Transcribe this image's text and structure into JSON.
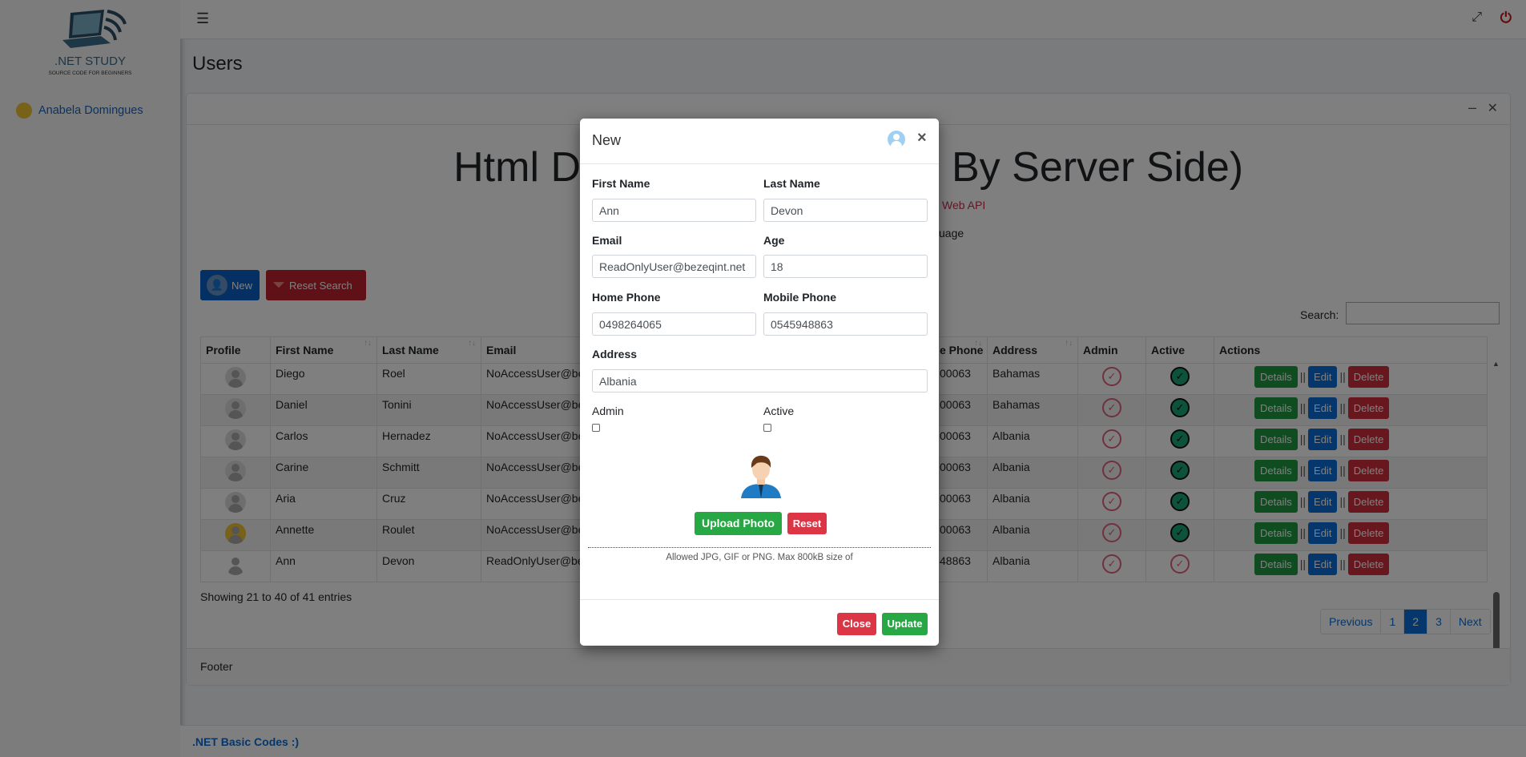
{
  "brand": {
    "title": ".NET STUDY",
    "subtitle": "SOURCE CODE FOR BEGINNERS"
  },
  "sidebar": {
    "user_name": "Anabela Domingues"
  },
  "topnav": {
    "menu_icon": "hamburger-icon",
    "expand_icon": "expand-icon",
    "power_icon": "power-icon"
  },
  "page": {
    "title": "Users"
  },
  "card": {
    "heading_left": "Html D",
    "heading_right": "By Server Side)",
    "subtitle_fragment": "Web API",
    "desc_fragment": "uage",
    "new_label": "New",
    "reset_search_label": "Reset Search",
    "search_label": "Search:",
    "footer": "Footer"
  },
  "table": {
    "headers": [
      "Profile",
      "First Name",
      "Last Name",
      "Email",
      "e Phone",
      "Address",
      "Admin",
      "Active",
      "Actions"
    ],
    "rows": [
      {
        "avatar": "default",
        "first": "Diego",
        "last": "Roel",
        "email": "NoAccessUser@be",
        "phone": "00063",
        "address": "Bahamas",
        "admin": false,
        "active": true
      },
      {
        "avatar": "default",
        "first": "Daniel",
        "last": "Tonini",
        "email": "NoAccessUser@be",
        "phone": "00063",
        "address": "Bahamas",
        "admin": false,
        "active": true
      },
      {
        "avatar": "default",
        "first": "Carlos",
        "last": "Hernadez",
        "email": "NoAccessUser@be",
        "phone": "00063",
        "address": "Albania",
        "admin": false,
        "active": true
      },
      {
        "avatar": "default",
        "first": "Carine",
        "last": "Schmitt",
        "email": "NoAccessUser@be",
        "phone": "00063",
        "address": "Albania",
        "admin": false,
        "active": true
      },
      {
        "avatar": "default",
        "first": "Aria",
        "last": "Cruz",
        "email": "NoAccessUser@be",
        "phone": "00063",
        "address": "Albania",
        "admin": false,
        "active": true
      },
      {
        "avatar": "female",
        "first": "Annette",
        "last": "Roulet",
        "email": "NoAccessUser@be",
        "phone": "00063",
        "address": "Albania",
        "admin": false,
        "active": true
      },
      {
        "avatar": "male",
        "first": "Ann",
        "last": "Devon",
        "email": "ReadOnlyUser@be",
        "phone": "48863",
        "address": "Albania",
        "admin": false,
        "active": false
      }
    ],
    "actions": {
      "details": "Details",
      "edit": "Edit",
      "delete": "Delete",
      "separator": "||"
    },
    "info": "Showing 21 to 40 of 41 entries",
    "pagination": [
      "Previous",
      "1",
      "2",
      "3",
      "Next"
    ],
    "current_page": "2"
  },
  "footer": {
    "text": ".NET Basic Codes :)"
  },
  "modal": {
    "title": "New",
    "close_symbol": "×",
    "fields": {
      "first_name": {
        "label": "First Name",
        "value": "Ann"
      },
      "last_name": {
        "label": "Last Name",
        "value": "Devon"
      },
      "email": {
        "label": "Email",
        "value": "ReadOnlyUser@bezeqint.net"
      },
      "age": {
        "label": "Age",
        "value": "18"
      },
      "home_phone": {
        "label": "Home Phone",
        "value": "0498264065"
      },
      "mobile_phone": {
        "label": "Mobile Phone",
        "value": "0545948863"
      },
      "address": {
        "label": "Address",
        "value": "Albania"
      },
      "admin": {
        "label": "Admin",
        "checked": false
      },
      "active": {
        "label": "Active",
        "checked": false
      }
    },
    "upload_label": "Upload Photo",
    "reset_label": "Reset",
    "hint": "Allowed JPG, GIF or PNG. Max 800kB size of",
    "close_label": "Close",
    "update_label": "Update"
  },
  "colors": {
    "primary": "#0b6dd8",
    "success": "#28a745",
    "danger": "#dc3545"
  }
}
